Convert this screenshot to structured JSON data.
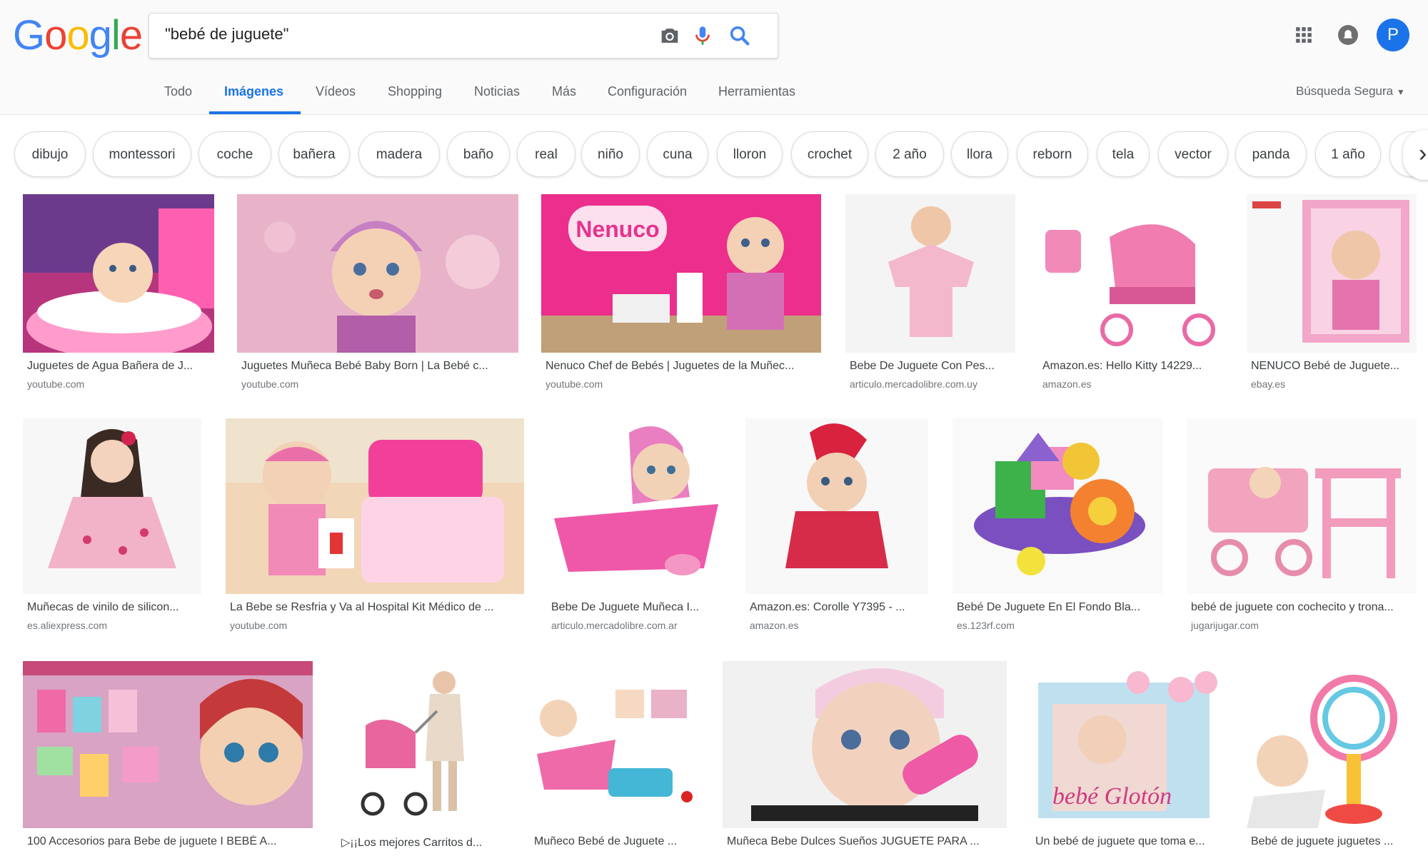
{
  "header": {
    "logo": "Google",
    "search_query": "\"bebé de juguete\"",
    "avatar_letter": "P"
  },
  "tabs": [
    "Todo",
    "Imágenes",
    "Vídeos",
    "Shopping",
    "Noticias",
    "Más",
    "Configuración",
    "Herramientas"
  ],
  "active_tab": "Imágenes",
  "safe_search": "Búsqueda Segura",
  "chips": [
    "dibujo",
    "montessori",
    "coche",
    "bañera",
    "madera",
    "baño",
    "real",
    "niño",
    "cuna",
    "lloron",
    "crochet",
    "2 año",
    "llora",
    "reborn",
    "tela",
    "vector",
    "panda",
    "1 año"
  ],
  "icons": {
    "camera": "camera-icon",
    "mic": "microphone-icon",
    "search": "search-icon",
    "apps": "apps-grid-icon",
    "notifications": "notifications-icon",
    "next": "chevron-right-icon"
  },
  "colors": {
    "accent": "#1a73e8",
    "pink": "#e94c9a",
    "text": "#3c4043",
    "muted": "#70757a"
  },
  "results": [
    {
      "caption": "Juguetes de Agua Bañera de J...",
      "domain": "youtube.com"
    },
    {
      "caption": "Juguetes Muñeca Bebé Baby Born | La Bebé c...",
      "domain": "youtube.com"
    },
    {
      "caption": "Nenuco Chef de Bebés | Juguetes de la Muñec...",
      "domain": "youtube.com",
      "image_text": "Nenuco"
    },
    {
      "caption": "Bebe De Juguete Con Pes...",
      "domain": "articulo.mercadolibre.com.uy"
    },
    {
      "caption": "Amazon.es: Hello Kitty 14229...",
      "domain": "amazon.es"
    },
    {
      "caption": "NENUCO Bebé de Juguete...",
      "domain": "ebay.es"
    },
    {
      "caption": "Muñecas de vinilo de silicon...",
      "domain": "es.aliexpress.com"
    },
    {
      "caption": "La Bebe se Resfria y Va al Hospital Kit Médico de ...",
      "domain": "youtube.com"
    },
    {
      "caption": "Bebe De Juguete Muñeca I...",
      "domain": "articulo.mercadolibre.com.ar"
    },
    {
      "caption": "Amazon.es: Corolle Y7395 - ...",
      "domain": "amazon.es"
    },
    {
      "caption": "Bebé De Juguete En El Fondo Bla...",
      "domain": "es.123rf.com"
    },
    {
      "caption": "bebé de juguete con cochecito y trona...",
      "domain": "jugarijugar.com"
    },
    {
      "caption": "100 Accesorios para Bebe de juguete I BEBÉ A...",
      "domain": ""
    },
    {
      "caption": "▷¡¡Los mejores Carritos d...",
      "domain": ""
    },
    {
      "caption": "Muñeco Bebé de Juguete ...",
      "domain": ""
    },
    {
      "caption": "Muñeca Bebe Dulces Sueños JUGUETE PARA ...",
      "domain": ""
    },
    {
      "caption": "Un bebé de juguete que toma e...",
      "domain": "",
      "image_text": "bebé Glotón"
    },
    {
      "caption": "Bebé de juguete juguetes ...",
      "domain": ""
    }
  ]
}
